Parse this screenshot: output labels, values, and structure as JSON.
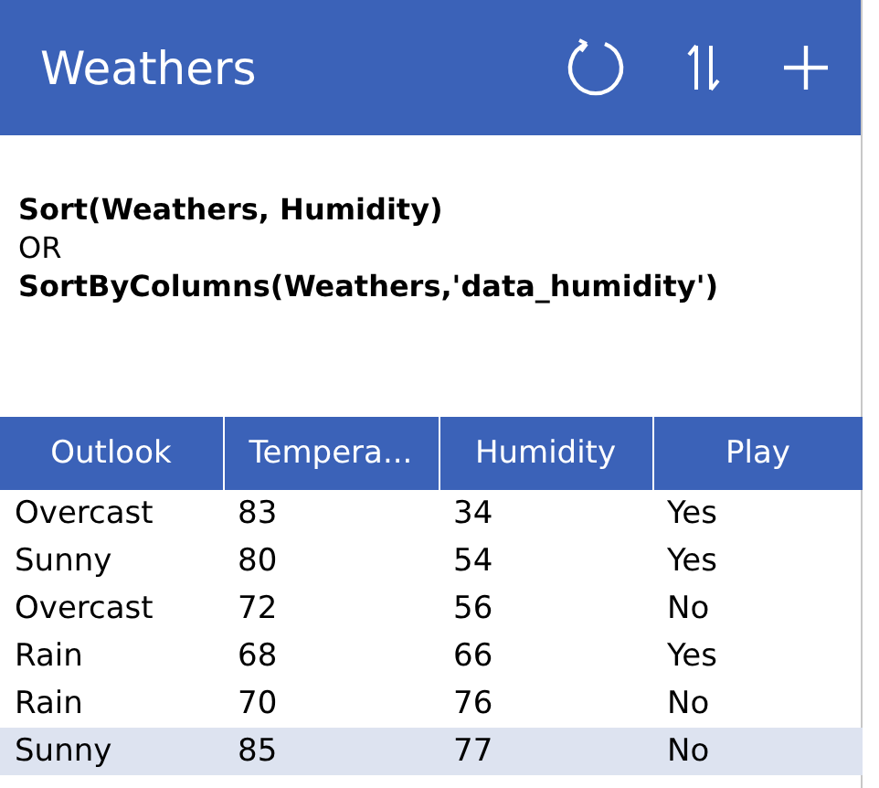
{
  "header": {
    "title": "Weathers"
  },
  "formula": [
    {
      "text": "Sort(Weathers, Humidity)",
      "kind": "code"
    },
    {
      "text": "OR",
      "kind": "plain"
    },
    {
      "text": "SortByColumns(Weathers,'data_humidity')",
      "kind": "code"
    }
  ],
  "table": {
    "columns": [
      "Outlook",
      "Tempera...",
      "Humidity",
      "Play"
    ],
    "rows": [
      {
        "cells": [
          "Overcast",
          "83",
          "34",
          "Yes"
        ],
        "selected": false
      },
      {
        "cells": [
          "Sunny",
          "80",
          "54",
          "Yes"
        ],
        "selected": false
      },
      {
        "cells": [
          "Overcast",
          "72",
          "56",
          "No"
        ],
        "selected": false
      },
      {
        "cells": [
          "Rain",
          "68",
          "66",
          "Yes"
        ],
        "selected": false
      },
      {
        "cells": [
          "Rain",
          "70",
          "76",
          "No"
        ],
        "selected": false
      },
      {
        "cells": [
          "Sunny",
          "85",
          "77",
          "No"
        ],
        "selected": true
      }
    ]
  }
}
